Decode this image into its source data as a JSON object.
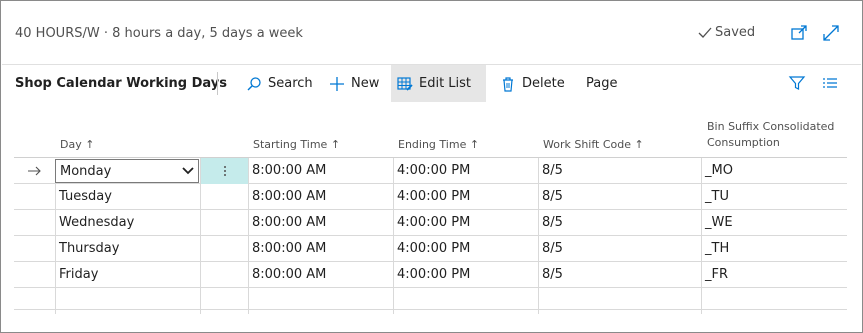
{
  "header": {
    "title": "40 HOURS/W · 8 hours a day, 5 days a week",
    "saved_label": "Saved",
    "icons": [
      "checkmark-icon",
      "open-in-new-window-icon",
      "expand-icon"
    ]
  },
  "actionbar": {
    "part_title": "Shop Calendar Working Days",
    "search_label": "Search",
    "new_label": "New",
    "edit_list_label": "Edit List",
    "delete_label": "Delete",
    "page_label": "Page"
  },
  "grid": {
    "columns": {
      "day": "Day",
      "starting_time": "Starting Time",
      "ending_time": "Ending Time",
      "work_shift_code": "Work Shift Code",
      "bin_suffix": "Bin Suffix Consolidated Consumption"
    },
    "sort_glyph": "↑",
    "rows": [
      {
        "day": "Monday",
        "start": "8:00:00 AM",
        "end": "4:00:00 PM",
        "shift": "8/5",
        "suffix": "_MO"
      },
      {
        "day": "Tuesday",
        "start": "8:00:00 AM",
        "end": "4:00:00 PM",
        "shift": "8/5",
        "suffix": "_TU"
      },
      {
        "day": "Wednesday",
        "start": "8:00:00 AM",
        "end": "4:00:00 PM",
        "shift": "8/5",
        "suffix": "_WE"
      },
      {
        "day": "Thursday",
        "start": "8:00:00 AM",
        "end": "4:00:00 PM",
        "shift": "8/5",
        "suffix": "_TH"
      },
      {
        "day": "Friday",
        "start": "8:00:00 AM",
        "end": "4:00:00 PM",
        "shift": "8/5",
        "suffix": "_FR"
      }
    ]
  },
  "colors": {
    "accent": "#0078d4",
    "selected_menu_cell": "#c5ebeb",
    "active_action": "#e6e6e6"
  }
}
